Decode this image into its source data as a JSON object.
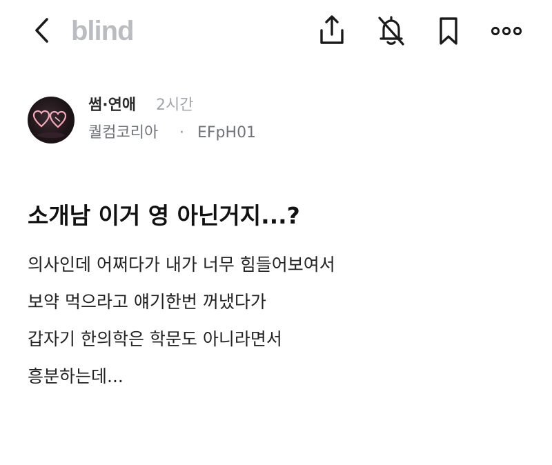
{
  "header": {
    "brand": "blind",
    "icons": [
      "back-icon",
      "share-icon",
      "notification-off-icon",
      "bookmark-icon",
      "more-icon"
    ],
    "colors": {
      "brand": "#b9bcc1",
      "icon": "#1a1a1a"
    }
  },
  "post": {
    "category": "썸·연애",
    "time": "2시간",
    "company": "퀄컴코리아",
    "separator": "·",
    "nickname": "EFpH01",
    "title": "소개남 이거 영 아닌거지...?",
    "body_lines": [
      "의사인데 어쩌다가 내가 너무 힘들어보여서",
      "보약 먹으라고 얘기한번 꺼냈다가",
      "갑자기 한의학은 학문도 아니라면서",
      "흥분하는데..."
    ]
  }
}
